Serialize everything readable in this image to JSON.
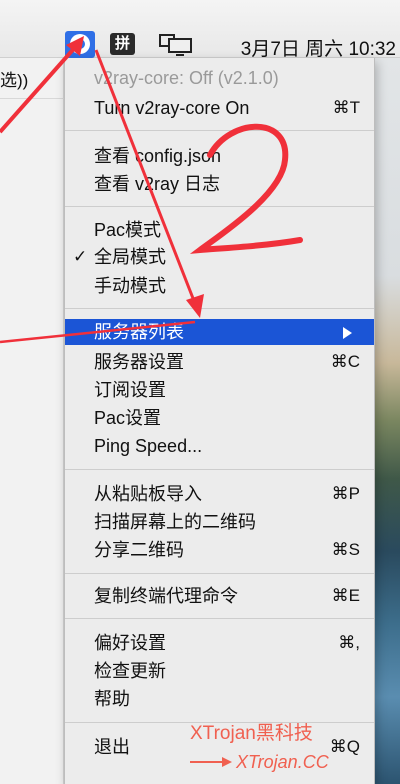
{
  "menubar": {
    "clock": "3月7日 周六 10:32",
    "pinyin_label": "拼",
    "icons": [
      "v2ray-icon",
      "pinyin-input-icon",
      "display-mirroring-icon"
    ]
  },
  "left_window": {
    "text": "选))"
  },
  "menu": {
    "header": "v2ray-core: Off  (v2.1.0)",
    "items": [
      {
        "label": "Turn v2ray-core On",
        "shortcut": "⌘T"
      },
      {
        "label": "查看 config.json",
        "shortcut": ""
      },
      {
        "label": "查看 v2ray 日志",
        "shortcut": ""
      },
      {
        "label": "Pac模式",
        "shortcut": ""
      },
      {
        "label": "全局模式",
        "shortcut": "",
        "checked": true
      },
      {
        "label": "手动模式",
        "shortcut": ""
      },
      {
        "label": "服务器列表",
        "shortcut": "",
        "submenu": true,
        "selected": true
      },
      {
        "label": "服务器设置",
        "shortcut": "⌘C"
      },
      {
        "label": "订阅设置",
        "shortcut": ""
      },
      {
        "label": "Pac设置",
        "shortcut": ""
      },
      {
        "label": "Ping Speed...",
        "shortcut": ""
      },
      {
        "label": "从粘贴板导入",
        "shortcut": "⌘P"
      },
      {
        "label": "扫描屏幕上的二维码",
        "shortcut": ""
      },
      {
        "label": "分享二维码",
        "shortcut": "⌘S"
      },
      {
        "label": "复制终端代理命令",
        "shortcut": "⌘E"
      },
      {
        "label": "偏好设置",
        "shortcut": "⌘,"
      },
      {
        "label": "检查更新",
        "shortcut": ""
      },
      {
        "label": "帮助",
        "shortcut": ""
      },
      {
        "label": "退出",
        "shortcut": "⌘Q"
      }
    ],
    "check_mark": "✓"
  },
  "annotation": {
    "number": "2",
    "watermark_title": "XTrojan黑科技",
    "watermark_subtitle": "XTrojan.CC",
    "color": "#f0303a"
  },
  "colors": {
    "selection": "#1b55d6",
    "menu_bg": "#ececec",
    "v2ray_icon": "#2f6fe6"
  }
}
